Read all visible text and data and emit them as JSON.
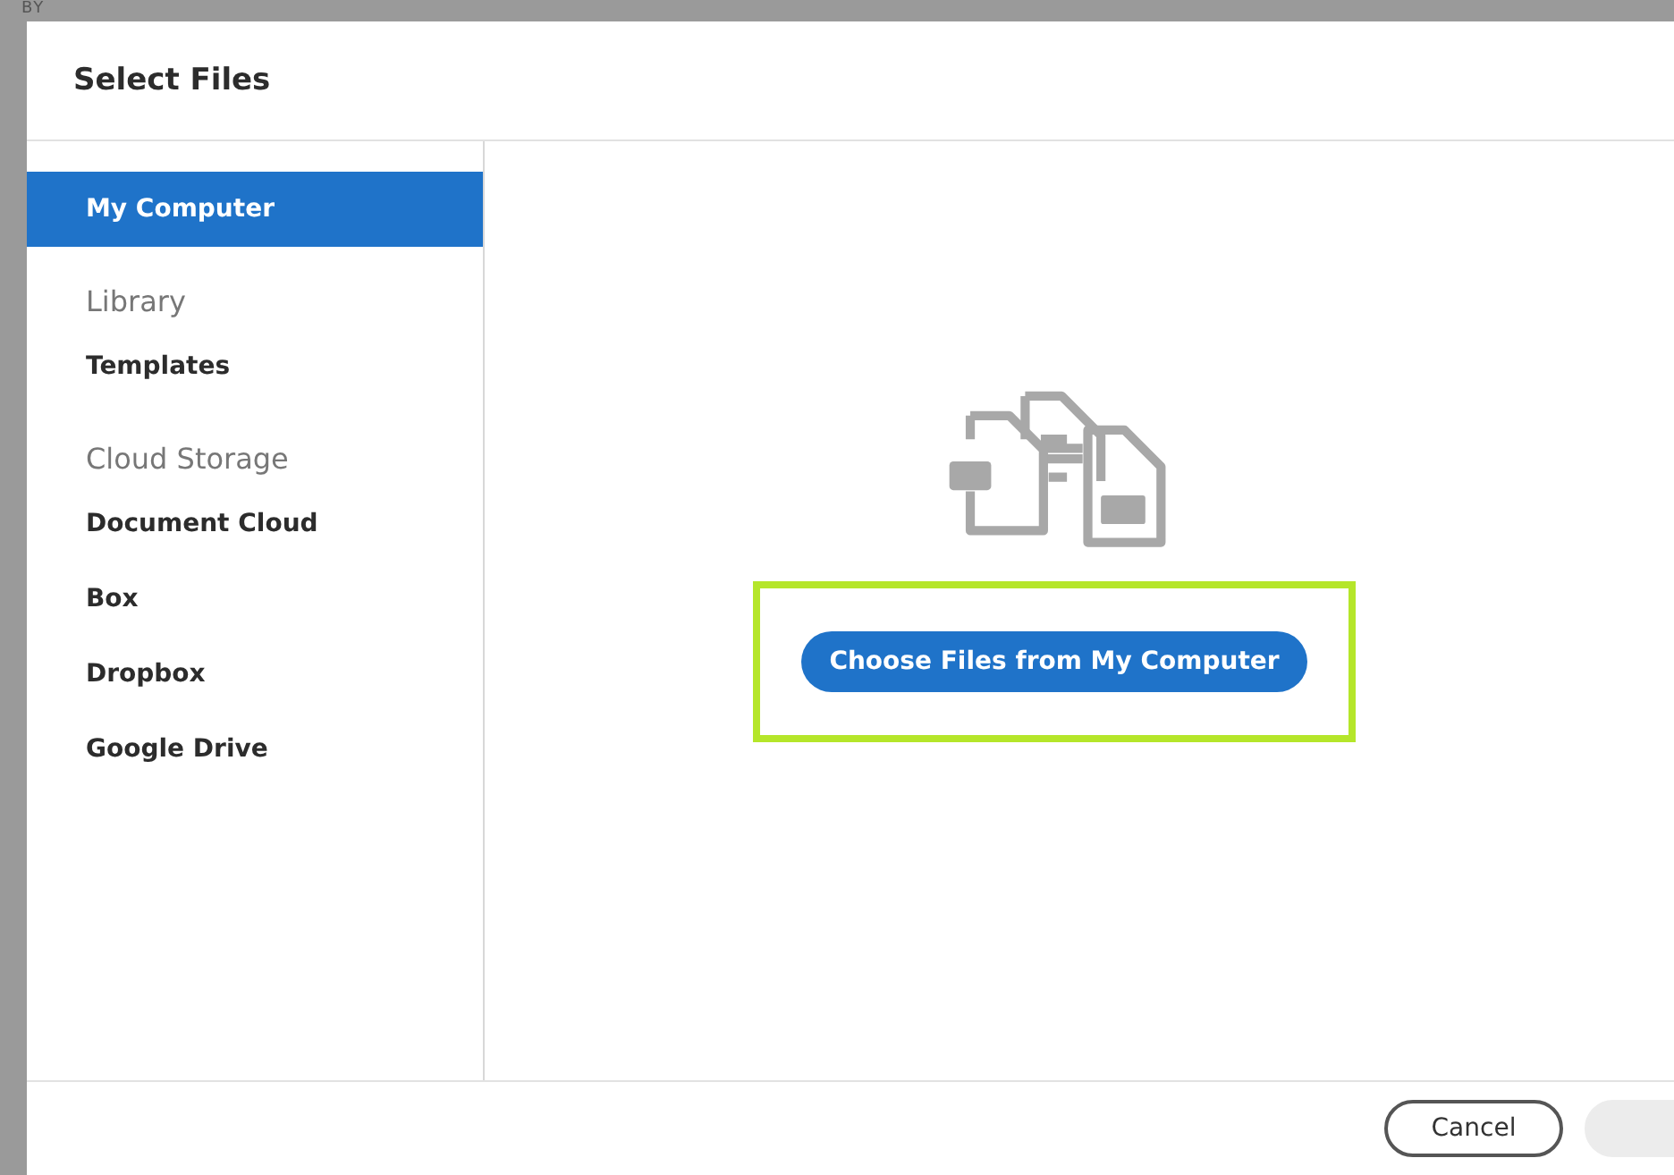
{
  "backdrop": {
    "text": "BY"
  },
  "dialog": {
    "title": "Select Files"
  },
  "sidebar": {
    "items": [
      {
        "kind": "item",
        "label": "My Computer",
        "selected": true
      },
      {
        "kind": "heading",
        "label": "Library"
      },
      {
        "kind": "item",
        "label": "Templates",
        "selected": false
      },
      {
        "kind": "heading",
        "label": "Cloud Storage"
      },
      {
        "kind": "item",
        "label": "Document Cloud",
        "selected": false
      },
      {
        "kind": "item",
        "label": "Box",
        "selected": false
      },
      {
        "kind": "item",
        "label": "Dropbox",
        "selected": false
      },
      {
        "kind": "item",
        "label": "Google Drive",
        "selected": false
      }
    ]
  },
  "main": {
    "button": "Choose Files from My Computer",
    "highlighted": true
  },
  "footer": {
    "buttons": [
      {
        "label": "Cancel",
        "disabled": false
      },
      {
        "disabled": true
      }
    ]
  }
}
